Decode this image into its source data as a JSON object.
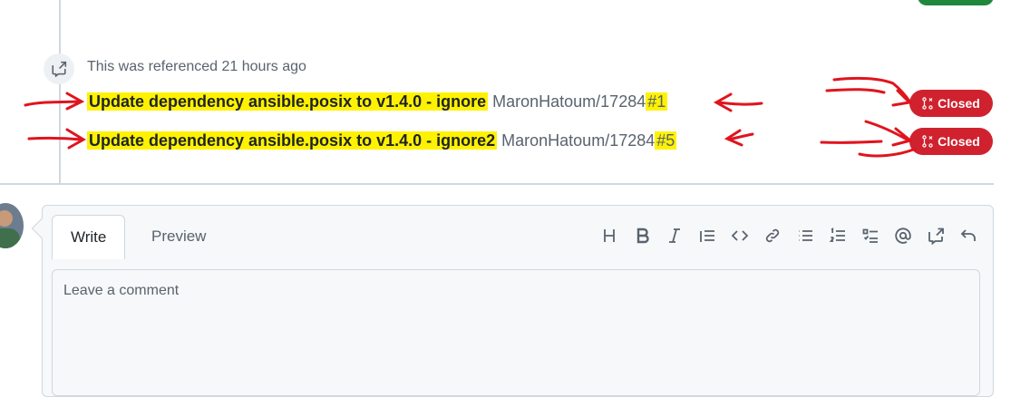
{
  "timeline": {
    "referenced_text": "This was referenced 21 hours ago",
    "references": [
      {
        "title": "Update dependency ansible.posix to v1.4.0 - ignore",
        "repo": "MaronHatoum/17284",
        "number": "#1",
        "status": "Closed"
      },
      {
        "title": "Update dependency ansible.posix to v1.4.0 - ignore2",
        "repo": "MaronHatoum/17284",
        "number": "#5",
        "status": "Closed"
      }
    ]
  },
  "composer": {
    "tabs": [
      {
        "label": "Write"
      },
      {
        "label": "Preview"
      }
    ],
    "placeholder": "Leave a comment",
    "toolbar": [
      "heading-icon",
      "bold-icon",
      "italic-icon",
      "quote-icon",
      "code-icon",
      "link-icon",
      "unordered-list-icon",
      "ordered-list-icon",
      "task-list-icon",
      "mention-icon",
      "reference-icon",
      "reply-icon"
    ]
  },
  "colors": {
    "closed_badge": "#cf222e",
    "highlight": "#fff200",
    "annotation_arrows": "#e0141e"
  }
}
